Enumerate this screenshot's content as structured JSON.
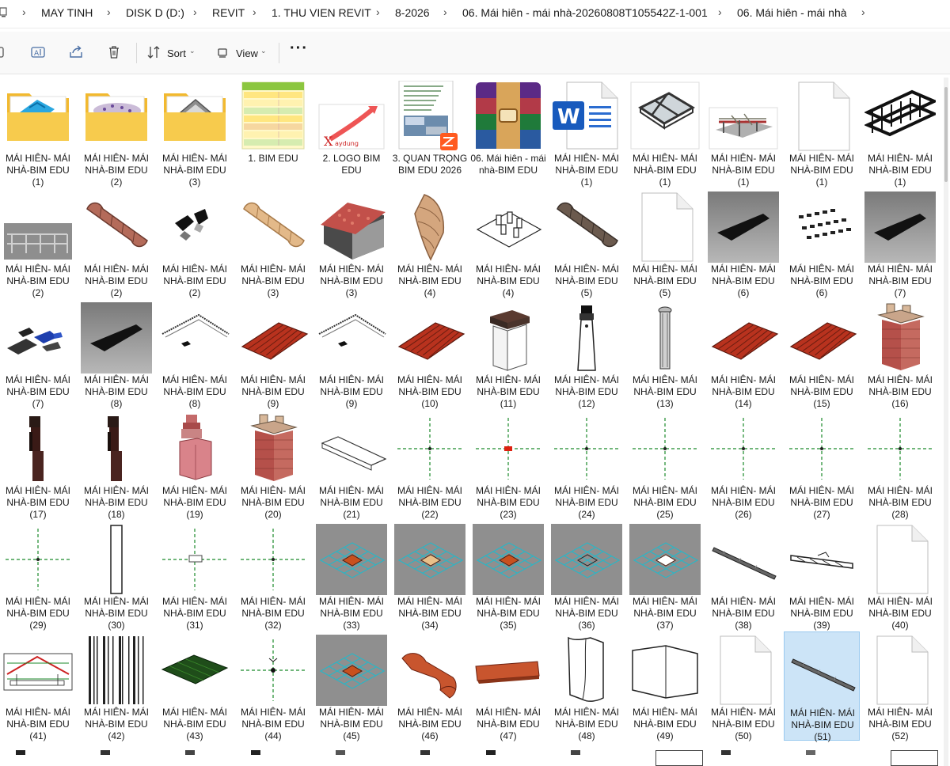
{
  "breadcrumb": [
    "MAY TINH",
    "DISK D (D:)",
    "REVIT",
    "1. THU VIEN REVIT",
    "8-2026",
    "06. Mái hiên - mái nhà-20260808T105542Z-1-001",
    "06. Mái hiên - mái nhà"
  ],
  "toolbar": {
    "sort_label": "Sort",
    "view_label": "View",
    "more_label": "···"
  },
  "items": [
    {
      "name": "MÁI HIÊN- MÁI NHÀ-BIM EDU (1)",
      "icon": "folder-blue"
    },
    {
      "name": "MÁI HIÊN- MÁI NHÀ-BIM EDU (2)",
      "icon": "folder-purple"
    },
    {
      "name": "MÁI HIÊN- MÁI NHÀ-BIM EDU (3)",
      "icon": "folder-roof"
    },
    {
      "name": "1. BIM EDU",
      "icon": "spreadsheet"
    },
    {
      "name": "2. LOGO BIM EDU",
      "icon": "logo"
    },
    {
      "name": "3. QUAN TRỌNG BIM EDU 2026",
      "icon": "pdf"
    },
    {
      "name": "06. Mái hiên - mái nhà-BIM EDU",
      "icon": "rar"
    },
    {
      "name": "MÁI HIÊN- MÁI NHÀ-BIM EDU (1)",
      "icon": "word"
    },
    {
      "name": "MÁI HIÊN- MÁI NHÀ-BIM EDU (1)",
      "icon": "window"
    },
    {
      "name": "MÁI HIÊN- MÁI NHÀ-BIM EDU (1)",
      "icon": "pergola"
    },
    {
      "name": "MÁI HIÊN- MÁI NHÀ-BIM EDU (1)",
      "icon": "blank"
    },
    {
      "name": "MÁI HIÊN- MÁI NHÀ-BIM EDU (1)",
      "icon": "frame"
    },
    {
      "name": "MÁI HIÊN- MÁI NHÀ-BIM EDU (2)",
      "icon": "frame-gray"
    },
    {
      "name": "MÁI HIÊN- MÁI NHÀ-BIM EDU (2)",
      "icon": "ridge-tile"
    },
    {
      "name": "MÁI HIÊN- MÁI NHÀ-BIM EDU (2)",
      "icon": "bracket"
    },
    {
      "name": "MÁI HIÊN- MÁI NHÀ-BIM EDU (3)",
      "icon": "ridge-tile-light"
    },
    {
      "name": "MÁI HIÊN- MÁI NHÀ-BIM EDU (3)",
      "icon": "house"
    },
    {
      "name": "MÁI HIÊN- MÁI NHÀ-BIM EDU (4)",
      "icon": "curved-tile"
    },
    {
      "name": "MÁI HIÊN- MÁI NHÀ-BIM EDU (4)",
      "icon": "platform"
    },
    {
      "name": "MÁI HIÊN- MÁI NHÀ-BIM EDU (5)",
      "icon": "ridge-tile-dark"
    },
    {
      "name": "MÁI HIÊN- MÁI NHÀ-BIM EDU (5)",
      "icon": "blank"
    },
    {
      "name": "MÁI HIÊN- MÁI NHÀ-BIM EDU (6)",
      "icon": "dark-panel"
    },
    {
      "name": "MÁI HIÊN- MÁI NHÀ-BIM EDU (6)",
      "icon": "dots"
    },
    {
      "name": "MÁI HIÊN- MÁI NHÀ-BIM EDU (7)",
      "icon": "dark-panel"
    },
    {
      "name": "MÁI HIÊN- MÁI NHÀ-BIM EDU (7)",
      "icon": "blue-parts"
    },
    {
      "name": "MÁI HIÊN- MÁI NHÀ-BIM EDU (8)",
      "icon": "dark-panel"
    },
    {
      "name": "MÁI HIÊN- MÁI NHÀ-BIM EDU (8)",
      "icon": "eave-line"
    },
    {
      "name": "MÁI HIÊN- MÁI NHÀ-BIM EDU (9)",
      "icon": "red-tiles"
    },
    {
      "name": "MÁI HIÊN- MÁI NHÀ-BIM EDU (9)",
      "icon": "eave-line"
    },
    {
      "name": "MÁI HIÊN- MÁI NHÀ-BIM EDU (10)",
      "icon": "red-tiles"
    },
    {
      "name": "MÁI HIÊN- MÁI NHÀ-BIM EDU (11)",
      "icon": "chimney-white"
    },
    {
      "name": "MÁI HIÊN- MÁI NHÀ-BIM EDU (12)",
      "icon": "column"
    },
    {
      "name": "MÁI HIÊN- MÁI NHÀ-BIM EDU (13)",
      "icon": "column-gray"
    },
    {
      "name": "MÁI HIÊN- MÁI NHÀ-BIM EDU (14)",
      "icon": "red-tiles"
    },
    {
      "name": "MÁI HIÊN- MÁI NHÀ-BIM EDU (15)",
      "icon": "red-tiles"
    },
    {
      "name": "MÁI HIÊN- MÁI NHÀ-BIM EDU (16)",
      "icon": "chimney-brick"
    },
    {
      "name": "MÁI HIÊN- MÁI NHÀ-BIM EDU (17)",
      "icon": "chimney-dark"
    },
    {
      "name": "MÁI HIÊN- MÁI NHÀ-BIM EDU (18)",
      "icon": "chimney-dark"
    },
    {
      "name": "MÁI HIÊN- MÁI NHÀ-BIM EDU (19)",
      "icon": "chimney-pink"
    },
    {
      "name": "MÁI HIÊN- MÁI NHÀ-BIM EDU (20)",
      "icon": "chimney-brick"
    },
    {
      "name": "MÁI HIÊN- MÁI NHÀ-BIM EDU (21)",
      "icon": "gutter"
    },
    {
      "name": "MÁI HIÊN- MÁI NHÀ-BIM EDU (22)",
      "icon": "crosshair"
    },
    {
      "name": "MÁI HIÊN- MÁI NHÀ-BIM EDU (23)",
      "icon": "crosshair-red"
    },
    {
      "name": "MÁI HIÊN- MÁI NHÀ-BIM EDU (24)",
      "icon": "crosshair"
    },
    {
      "name": "MÁI HIÊN- MÁI NHÀ-BIM EDU (25)",
      "icon": "crosshair"
    },
    {
      "name": "MÁI HIÊN- MÁI NHÀ-BIM EDU (26)",
      "icon": "crosshair"
    },
    {
      "name": "MÁI HIÊN- MÁI NHÀ-BIM EDU (27)",
      "icon": "crosshair"
    },
    {
      "name": "MÁI HIÊN- MÁI NHÀ-BIM EDU (28)",
      "icon": "crosshair"
    },
    {
      "name": "MÁI HIÊN- MÁI NHÀ-BIM EDU (29)",
      "icon": "crosshair"
    },
    {
      "name": "MÁI HIÊN- MÁI NHÀ-BIM EDU (30)",
      "icon": "post"
    },
    {
      "name": "MÁI HIÊN- MÁI NHÀ-BIM EDU (31)",
      "icon": "crosshair-box"
    },
    {
      "name": "MÁI HIÊN- MÁI NHÀ-BIM EDU (32)",
      "icon": "crosshair"
    },
    {
      "name": "MÁI HIÊN- MÁI NHÀ-BIM EDU (33)",
      "icon": "grid-orange"
    },
    {
      "name": "MÁI HIÊN- MÁI NHÀ-BIM EDU (34)",
      "icon": "grid-tan"
    },
    {
      "name": "MÁI HIÊN- MÁI NHÀ-BIM EDU (35)",
      "icon": "grid-orange"
    },
    {
      "name": "MÁI HIÊN- MÁI NHÀ-BIM EDU (36)",
      "icon": "grid-diamond"
    },
    {
      "name": "MÁI HIÊN- MÁI NHÀ-BIM EDU (37)",
      "icon": "grid-white"
    },
    {
      "name": "MÁI HIÊN- MÁI NHÀ-BIM EDU (38)",
      "icon": "rod"
    },
    {
      "name": "MÁI HIÊN- MÁI NHÀ-BIM EDU (39)",
      "icon": "truss"
    },
    {
      "name": "MÁI HIÊN- MÁI NHÀ-BIM EDU (40)",
      "icon": "blank"
    },
    {
      "name": "MÁI HIÊN- MÁI NHÀ-BIM EDU (41)",
      "icon": "drawing"
    },
    {
      "name": "MÁI HIÊN- MÁI NHÀ-BIM EDU (42)",
      "icon": "stripes"
    },
    {
      "name": "MÁI HIÊN- MÁI NHÀ-BIM EDU (43)",
      "icon": "green-panel"
    },
    {
      "name": "MÁI HIÊN- MÁI NHÀ-BIM EDU (44)",
      "icon": "crosshair-green"
    },
    {
      "name": "MÁI HIÊN- MÁI NHÀ-BIM EDU (45)",
      "icon": "grid-orange"
    },
    {
      "name": "MÁI HIÊN- MÁI NHÀ-BIM EDU (46)",
      "icon": "tile-piece"
    },
    {
      "name": "MÁI HIÊN- MÁI NHÀ-BIM EDU (47)",
      "icon": "tile-flat"
    },
    {
      "name": "MÁI HIÊN- MÁI NHÀ-BIM EDU (48)",
      "icon": "sheet"
    },
    {
      "name": "MÁI HIÊN- MÁI NHÀ-BIM EDU (49)",
      "icon": "sheet-wide"
    },
    {
      "name": "MÁI HIÊN- MÁI NHÀ-BIM EDU (50)",
      "icon": "blank"
    },
    {
      "name": "MÁI HIÊN- MÁI NHÀ-BIM EDU (51)",
      "icon": "rod",
      "selected": true
    },
    {
      "name": "MÁI HIÊN- MÁI NHÀ-BIM EDU (52)",
      "icon": "blank"
    }
  ],
  "colors": {
    "selection": "#cce4f7",
    "folder": "#f4c542",
    "accent": "#0067c0"
  }
}
